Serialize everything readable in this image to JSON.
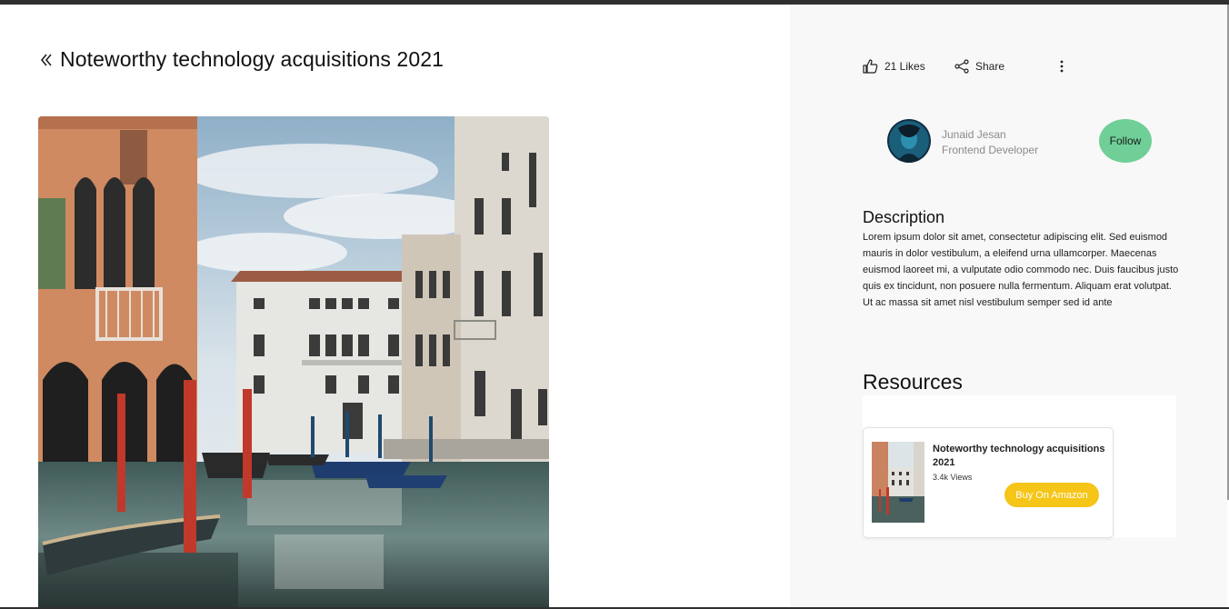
{
  "page": {
    "title": "Noteworthy technology acquisitions 2021"
  },
  "actions": {
    "likes_label": "21 Likes",
    "share_label": "Share"
  },
  "author": {
    "name": "Junaid Jesan",
    "role": "Frontend Developer",
    "follow_label": "Follow"
  },
  "description": {
    "heading": "Description",
    "text": "Lorem ipsum dolor sit amet, consectetur adipiscing elit. Sed euismod mauris in dolor vestibulum, a eleifend urna ullamcorper. Maecenas euismod laoreet mi, a vulputate odio commodo nec. Duis faucibus justo quis ex tincidunt, non posuere nulla fermentum. Aliquam erat volutpat. Ut ac massa sit amet nisl vestibulum semper sed id ante"
  },
  "resources": {
    "heading": "Resources",
    "items": [
      {
        "title": "Noteworthy technology acquisitions 2021",
        "views": "3.4k Views",
        "button_label": "Buy On Amazon"
      }
    ]
  },
  "colors": {
    "follow_button": "#6fcf97",
    "buy_button": "#f5c518",
    "sidebar_bg": "#f8f8f8"
  },
  "icons": {
    "back": "double-chevron-left-icon",
    "like": "thumbs-up-icon",
    "share": "share-icon",
    "more": "kebab-menu-icon"
  }
}
